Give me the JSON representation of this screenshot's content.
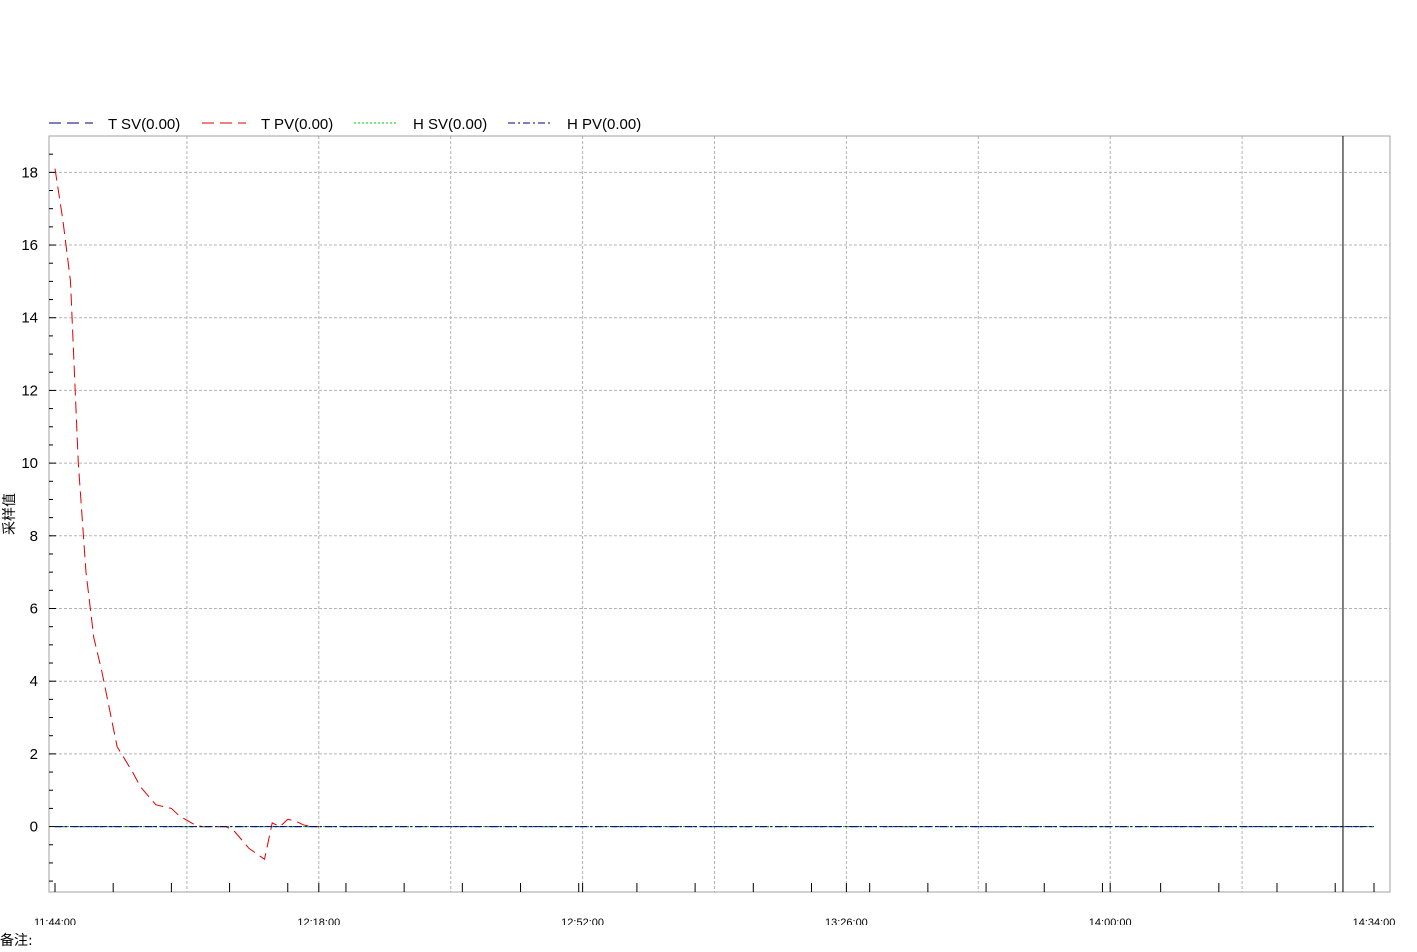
{
  "chart_data": {
    "type": "line",
    "ylabel": "采样值",
    "xlabel": "",
    "ylim": [
      -1.8,
      19
    ],
    "yticks": [
      0,
      2,
      4,
      6,
      8,
      10,
      12,
      14,
      16,
      18
    ],
    "x_tick_labels": [
      "11:44:00",
      "12:18:00",
      "12:52:00",
      "13:26:00",
      "14:00:00",
      "14:34:00"
    ],
    "grid": true,
    "legend_position": "top-left",
    "series": [
      {
        "name": "T SV(0.00)",
        "color": "#000080",
        "style": "long-dash",
        "x": [
          "11:44:00",
          "14:34:00"
        ],
        "values": [
          0,
          0
        ]
      },
      {
        "name": "T PV(0.00)",
        "color": "#e00000",
        "style": "long-dash",
        "x": [
          "11:44:00",
          "11:45:00",
          "11:46:00",
          "11:47:00",
          "11:48:00",
          "11:49:00",
          "11:50:00",
          "11:52:00",
          "11:54:00",
          "11:55:00",
          "11:57:00",
          "11:59:00",
          "12:00:00",
          "12:02:00",
          "12:03:00",
          "12:04:00",
          "12:06:00",
          "12:07:00",
          "12:09:00",
          "12:11:00",
          "12:12:00",
          "12:13:00",
          "12:14:00",
          "12:15:00",
          "12:16:00",
          "12:17:00",
          "12:18:00"
        ],
        "values": [
          18.1,
          16.7,
          15.0,
          10.0,
          7.0,
          5.2,
          4.3,
          2.2,
          1.5,
          1.1,
          0.6,
          0.5,
          0.3,
          0.05,
          0,
          0,
          0,
          -0.1,
          -0.6,
          -0.9,
          0.1,
          0.0,
          0.2,
          0.15,
          0.05,
          0.0,
          0.0
        ]
      },
      {
        "name": "H SV(0.00)",
        "color": "#00cc00",
        "style": "dotted",
        "x": [
          "11:44:00",
          "14:34:00"
        ],
        "values": [
          0,
          0
        ]
      },
      {
        "name": "H PV(0.00)",
        "color": "#000080",
        "style": "dash-dot",
        "x": [
          "11:44:00",
          "14:34:00"
        ],
        "values": [
          0,
          0
        ]
      }
    ],
    "cursor_time": "14:30:00"
  },
  "footer": {
    "remark_label": "备注:"
  }
}
